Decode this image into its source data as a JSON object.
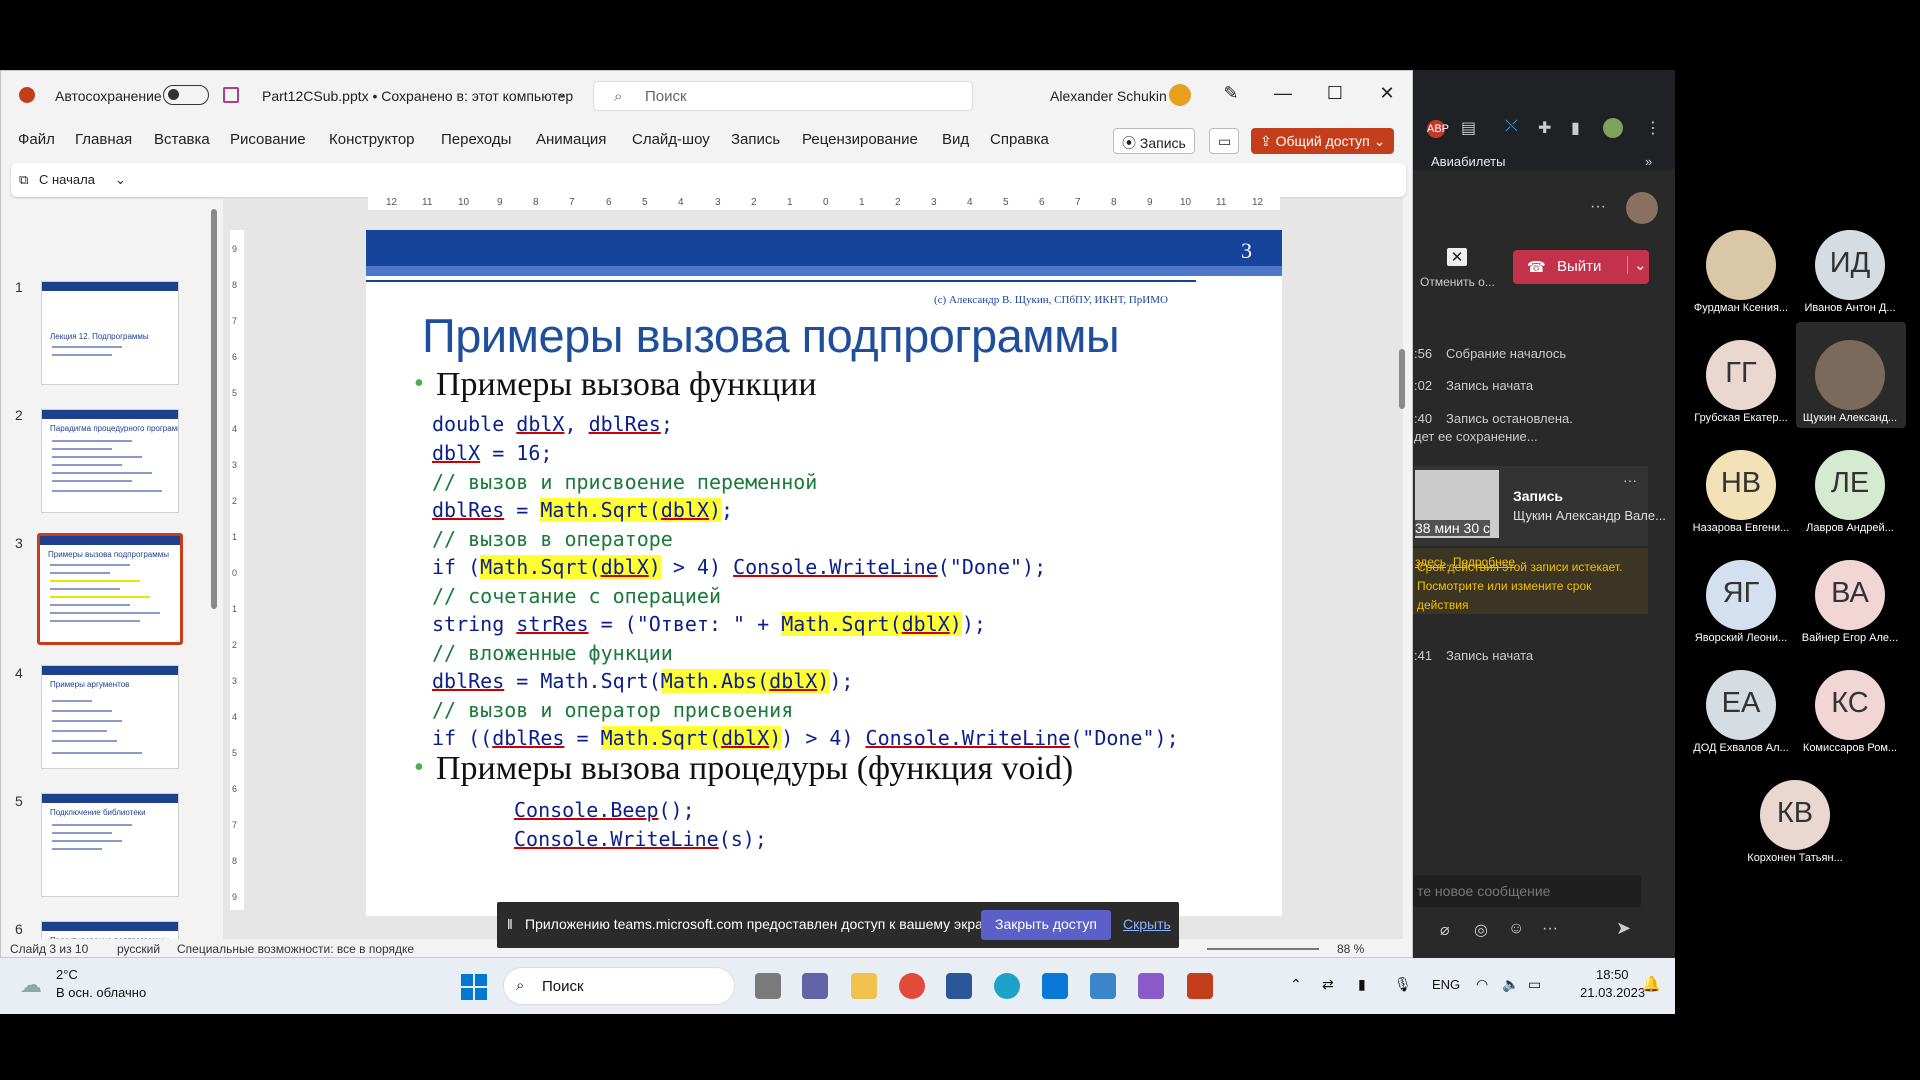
{
  "ppt": {
    "autosave_label": "Автосохранение",
    "filename": "Part12CSub.pptx • Сохранено в: этот компьютер",
    "search_placeholder": "Поиск",
    "user": "Alexander Schukin",
    "menu": [
      "Файл",
      "Главная",
      "Вставка",
      "Рисование",
      "Конструктор",
      "Переходы",
      "Анимация",
      "Слайд-шоу",
      "Запись",
      "Рецензирование",
      "Вид",
      "Справка"
    ],
    "record_btn": "Запись",
    "share_btn": "Общий доступ",
    "from_start": "С начала",
    "thumbs": [
      {
        "num": "1",
        "title": "Лекция 12. Подпрограммы"
      },
      {
        "num": "2",
        "title": "Парадигма процедурного программирования"
      },
      {
        "num": "3",
        "title": "Примеры вызова подпрограммы"
      },
      {
        "num": "4",
        "title": "Примеры аргументов"
      },
      {
        "num": "5",
        "title": "Подключение библиотеки"
      },
      {
        "num": "6",
        "title": "Проектирование подпрограммы"
      }
    ],
    "ruler_h": [
      "12",
      "11",
      "10",
      "9",
      "8",
      "7",
      "6",
      "5",
      "4",
      "3",
      "2",
      "1",
      "0",
      "1",
      "2",
      "3",
      "4",
      "5",
      "6",
      "7",
      "8",
      "9",
      "10",
      "11",
      "12"
    ],
    "ruler_v": [
      "9",
      "8",
      "7",
      "6",
      "5",
      "4",
      "3",
      "2",
      "1",
      "0",
      "1",
      "2",
      "3",
      "4",
      "5",
      "6",
      "7",
      "8",
      "9"
    ],
    "status": {
      "slide": "Слайд 3 из 10",
      "lang": "русский",
      "access": "Специальные возможности: все в порядке",
      "zoom": "88 %"
    }
  },
  "slide": {
    "number": "3",
    "credit": "(c) Александр В. Щукин, СПбПУ, ИКНТ, ПрИМО",
    "title": "Примеры вызова подпрограммы",
    "bullet1": "Примеры вызова функции",
    "bullet2": "Примеры вызова процедуры (функция void)"
  },
  "sharebar": {
    "text": "Приложению teams.microsoft.com предоставлен доступ к вашему экрану.",
    "stop": "Закрыть доступ",
    "hide": "Скрыть"
  },
  "teams": {
    "bookmark": "Авиабилеты",
    "cancel": "Отменить о...",
    "leave": "Выйти",
    "events": [
      {
        "time": ":56",
        "text": "Собрание началось"
      },
      {
        "time": ":02",
        "text": "Запись начата"
      },
      {
        "time": ":40",
        "text": "Запись остановлена."
      },
      {
        "time": "",
        "text": "дет ее сохранение..."
      }
    ],
    "rec_title": "Запись",
    "rec_author": "Щукин Александр Вале...",
    "rec_duration": "38 мин 30 с",
    "warning": "Срок действия этой записи истекает. Посмотрите или измените срок действия",
    "warning_link1": "здесь",
    "warning_link2": "Подробнее",
    "event_last_time": ":41",
    "event_last": "Запись начата",
    "msg_placeholder": "те новое сообщение"
  },
  "participants": [
    {
      "initials": "",
      "name": "Фурдман Ксения...",
      "color": "#d9c7a8"
    },
    {
      "initials": "ИД",
      "name": "Иванов Антон Д...",
      "color": "#d5dde3"
    },
    {
      "initials": "ГГ",
      "name": "Грубская Екатер...",
      "color": "#ead7cf"
    },
    {
      "initials": "",
      "name": "Щукин Александ...",
      "color": "#7b6a5c"
    },
    {
      "initials": "НВ",
      "name": "Назарова Евгени...",
      "color": "#f3e2b8"
    },
    {
      "initials": "ЛЕ",
      "name": "Лавров Андрей...",
      "color": "#d6ead2"
    },
    {
      "initials": "ЯГ",
      "name": "Яворский Леони...",
      "color": "#d4e0f0"
    },
    {
      "initials": "ВА",
      "name": "Вайнер Егор Але...",
      "color": "#f2d6d6"
    },
    {
      "initials": "ЕА",
      "name": "ДОД Ехвалов Ал...",
      "color": "#d5dde3"
    },
    {
      "initials": "КС",
      "name": "Комиссаров Ром...",
      "color": "#f2d6d6"
    },
    {
      "initials": "КВ",
      "name": "Корхонен Татьян...",
      "color": "#ead7cf"
    }
  ],
  "taskbar": {
    "temp": "2°C",
    "weather": "В осн. облачно",
    "search": "Поиск",
    "lang": "ENG",
    "time": "18:50",
    "date": "21.03.2023"
  }
}
